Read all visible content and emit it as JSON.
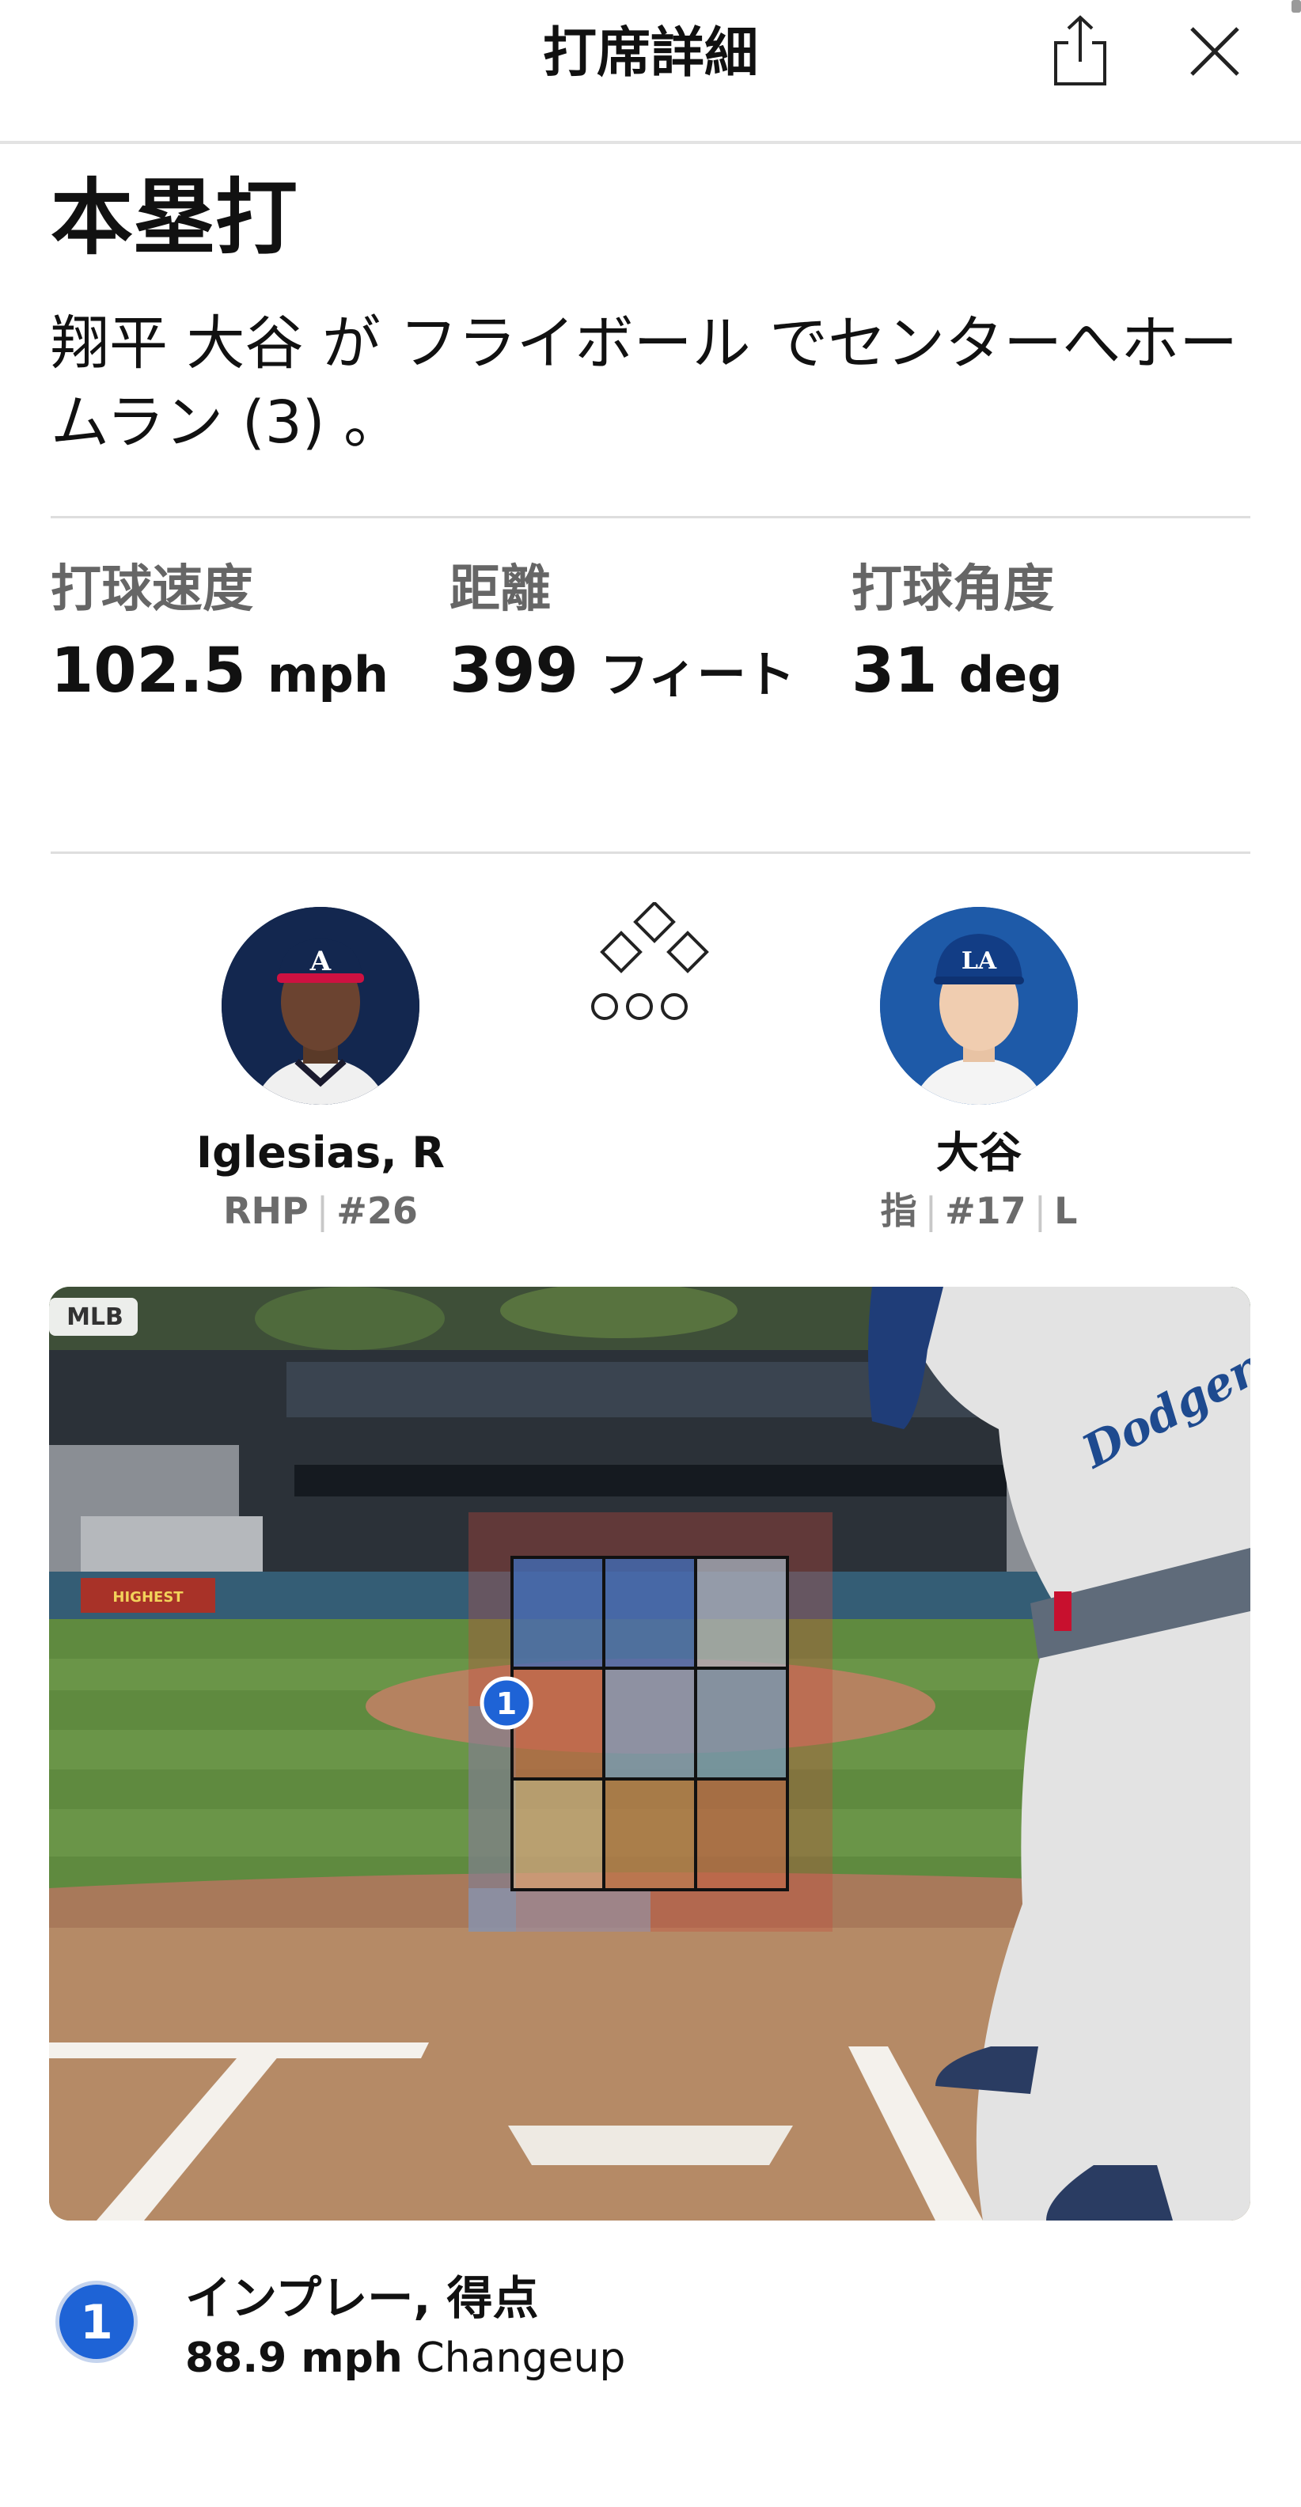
{
  "header": {
    "title": "打席詳細"
  },
  "result": {
    "title": "本塁打",
    "description": "翔平 大谷 が フライボール でセンターへホームラン (3) 。"
  },
  "stats": [
    {
      "label": "打球速度",
      "value": "102.5",
      "unit": "mph"
    },
    {
      "label": "距離",
      "value": "399",
      "unit": "フィート"
    },
    {
      "label": "打球角度",
      "value": "31",
      "unit": "deg"
    }
  ],
  "pitcher": {
    "name": "Iglesias, R",
    "hand": "RHP",
    "number": "#26",
    "cap_logo": "A"
  },
  "batter": {
    "name": "大谷",
    "position": "指",
    "number": "#17",
    "bats": "L",
    "cap_logo": "LA"
  },
  "bases": {
    "first": false,
    "second": false,
    "third": false,
    "outs": 0
  },
  "field": {
    "watermark": "MLB",
    "pitch_marker": "1",
    "jersey_text": "Dodgers",
    "sign_text": "HIGHEST"
  },
  "pitch": {
    "number": "1",
    "result": "インプレー, 得点",
    "speed": "88.9 mph",
    "type": "Changeup"
  },
  "colors": {
    "accent_blue": "#1e63d6",
    "braves_navy": "#13274f",
    "dodgers_blue": "#1e5aa8"
  }
}
